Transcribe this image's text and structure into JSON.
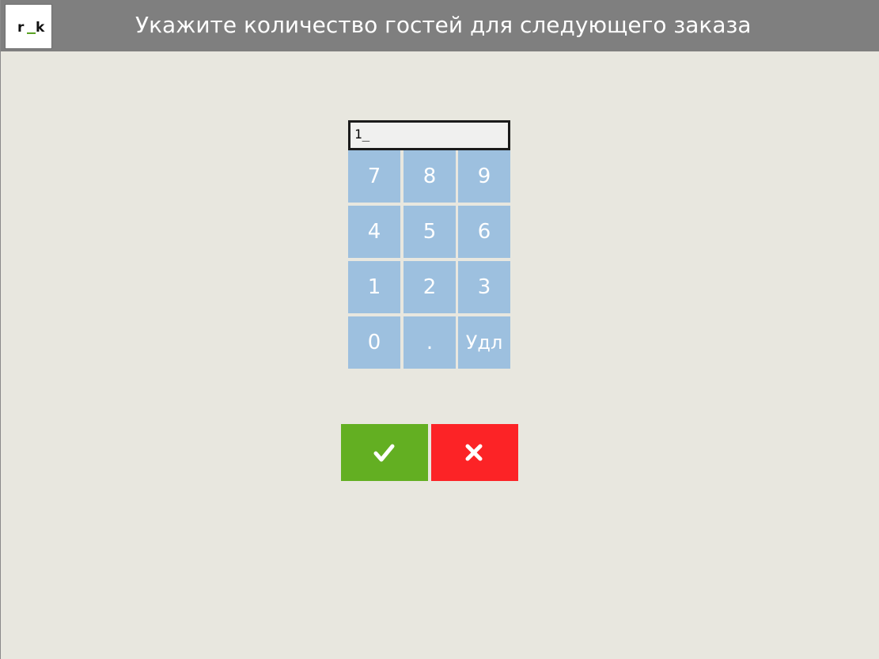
{
  "header": {
    "logo": {
      "part1": "r",
      "part2": "k",
      "accent_color": "#5aa324"
    },
    "title": "Укажите количество гостей для следующего заказа"
  },
  "entry": {
    "value": "1_"
  },
  "keypad": {
    "rows": [
      [
        "7",
        "8",
        "9"
      ],
      [
        "4",
        "5",
        "6"
      ],
      [
        "1",
        "2",
        "3"
      ],
      [
        "0",
        ".",
        "Удл"
      ]
    ]
  },
  "actions": {
    "confirm_icon": "checkmark-icon",
    "cancel_icon": "close-icon",
    "confirm_color": "#63af22",
    "cancel_color": "#fc2326"
  },
  "colors": {
    "titlebar": "#7f7f7f",
    "background": "#e8e7df",
    "key": "#9dc0df"
  }
}
